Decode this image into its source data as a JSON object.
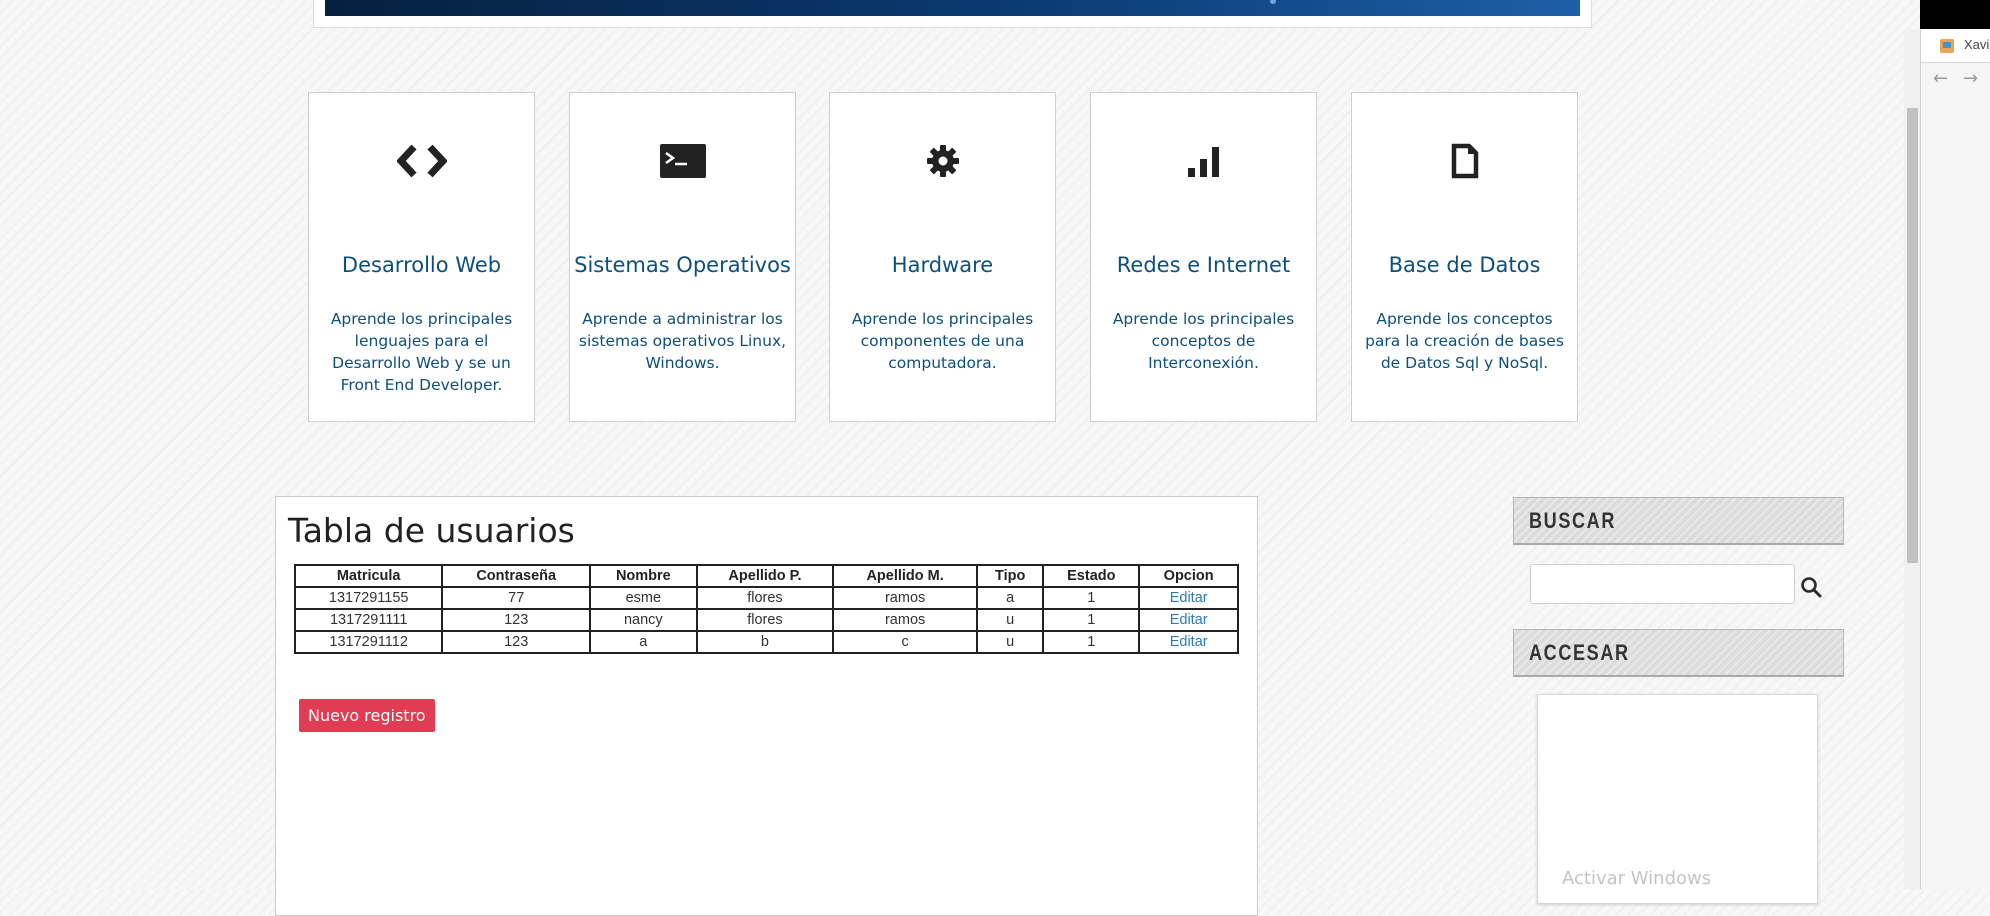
{
  "cards": [
    {
      "icon": "code-icon",
      "title": "Desarrollo Web",
      "desc": "Aprende los principales lenguajes para el Desarrollo Web y se un Front End Developer."
    },
    {
      "icon": "terminal-icon",
      "title": "Sistemas Operativos",
      "desc": "Aprende a administrar los sistemas operativos Linux, Windows."
    },
    {
      "icon": "gear-icon",
      "title": "Hardware",
      "desc": "Aprende los principales componentes de una computadora."
    },
    {
      "icon": "signal-bars-icon",
      "title": "Redes e Internet",
      "desc": "Aprende los principales conceptos de Interconexión."
    },
    {
      "icon": "document-icon",
      "title": "Base de Datos",
      "desc": "Aprende los conceptos para la creación de bases de Datos Sql y NoSql."
    }
  ],
  "users_table": {
    "title": "Tabla de usuarios",
    "headers": [
      "Matricula",
      "Contraseña",
      "Nombre",
      "Apellido P.",
      "Apellido M.",
      "Tipo",
      "Estado",
      "Opcion"
    ],
    "rows": [
      [
        "1317291155",
        "77",
        "esme",
        "flores",
        "ramos",
        "a",
        "1",
        "Editar"
      ],
      [
        "1317291111",
        "123",
        "nancy",
        "flores",
        "ramos",
        "u",
        "1",
        "Editar"
      ],
      [
        "1317291112",
        "123",
        "a",
        "b",
        "c",
        "u",
        "1",
        "Editar"
      ]
    ],
    "new_button": "Nuevo registro"
  },
  "sidebar": {
    "search_title": "BUSCAR",
    "search_value": "",
    "access_title": "ACCESAR"
  },
  "watermark": "Activar Windows",
  "browser": {
    "tab_title": "Xavie",
    "back_arrow": "←",
    "forward_arrow": "→"
  },
  "colors": {
    "card_title": "#0e4f7d",
    "link": "#2a7bb8",
    "new_button_bg": "#e23c55",
    "banner": "#0a3a72"
  }
}
